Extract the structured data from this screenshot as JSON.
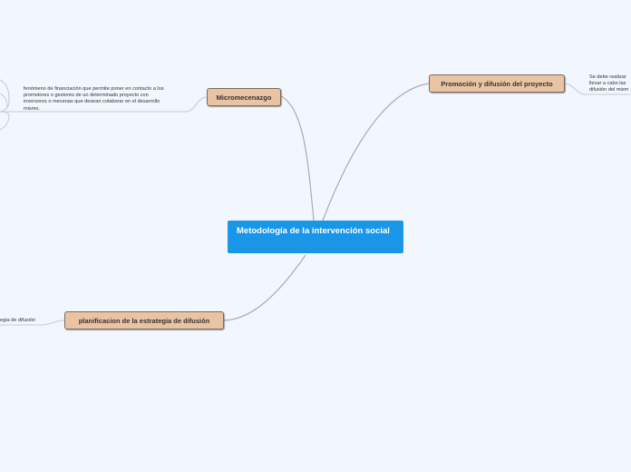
{
  "central": {
    "label": "Metodología de la intervención social"
  },
  "topics": [
    {
      "id": "micromecenazgo",
      "label": "Micromecenazgo"
    },
    {
      "id": "promocion",
      "label": "Promoción y difusión del proyecto"
    },
    {
      "id": "planificacion",
      "label": "planificacion de la estrategia de difusión"
    }
  ],
  "notes": {
    "micromecenazgo": "fenómeno de financiación que permite poner en contacto a los\npromotores o gestores de un determinado proyecto con\ninversores o mecenas que desean colaborar en el desarrollo\nmismo.",
    "promocion": "Se debe realizar\nllevar a cabo las\ndifusión del mism",
    "planificacion": "egia de difusión"
  },
  "colors": {
    "background": "#f2f6fd",
    "central": "#1a96e8",
    "topic_fill": "#e8c4a4",
    "topic_border": "#7b6a5e",
    "link": "#a9acb8"
  }
}
